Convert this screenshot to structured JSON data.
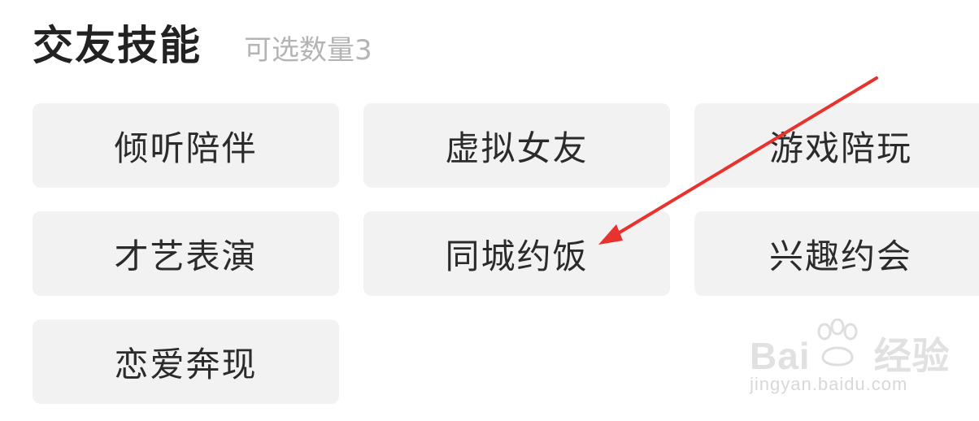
{
  "header": {
    "title": "交友技能",
    "subtitle": "可选数量3"
  },
  "skills": [
    {
      "label": "倾听陪伴"
    },
    {
      "label": "虚拟女友"
    },
    {
      "label": "游戏陪玩"
    },
    {
      "label": "才艺表演"
    },
    {
      "label": "同城约饭"
    },
    {
      "label": "兴趣约会"
    },
    {
      "label": "恋爱奔现"
    }
  ],
  "annotation": {
    "color": "#e8322d",
    "target": "同城约饭"
  },
  "watermark": {
    "logo_text_left": "Bai",
    "logo_text_right": "经验",
    "url": "jingyan.baidu.com"
  },
  "colors": {
    "chip_bg": "#f2f2f2",
    "title": "#222222",
    "subtitle": "#b4b4b4"
  }
}
